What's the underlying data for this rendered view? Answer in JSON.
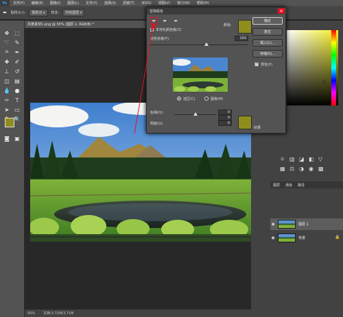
{
  "app": {
    "logo": "Ps"
  },
  "menubar": {
    "items": [
      "文件(F)",
      "编辑(E)",
      "图像(I)",
      "图层(L)",
      "文字(Y)",
      "选择(S)",
      "滤镜(T)",
      "3D(D)",
      "视图(V)",
      "窗口(W)",
      "帮助(H)"
    ]
  },
  "options": {
    "tool_preset": "",
    "sample_label": "取样大小:",
    "sample_value": "取样点",
    "sample_all_label": "样本:",
    "sample_all_value": "所有图层"
  },
  "document": {
    "tab_title": "风景素材1.png @ 50% (图层 1, RGB/8) *",
    "zoom": "50%",
    "doc_info": "文档:3.71M/3.71M"
  },
  "dialog": {
    "title": "替换颜色",
    "close_glyph": "✕",
    "localized_label": "本地化颜色簇(Z)",
    "color_label": "颜色:",
    "fuzziness_label": "颜色容差(F):",
    "fuzziness_value": "193",
    "ok_label": "确定",
    "reset_label": "复位",
    "load_label": "载入(L)...",
    "save_label": "存储(S)...",
    "preview_label": "预览(P)",
    "radio_selection": "选区(C)",
    "radio_image": "图像(M)",
    "replace": {
      "hue_label": "色相(H):",
      "hue_value": "0",
      "saturation_label": "饱和度(A):",
      "saturation_value": "0",
      "lightness_label": "明度(G):",
      "lightness_value": "0",
      "result_label": "结果"
    },
    "swatch_color": "#8f8e1c"
  },
  "layers": {
    "tabs": [
      "图层",
      "通道",
      "路径"
    ],
    "items": [
      {
        "name": "图层 1"
      },
      {
        "name": "背景"
      }
    ]
  },
  "colors": {
    "foreground": "#8f8e1c",
    "background": "#ffffff",
    "accent_red": "#e81123"
  }
}
